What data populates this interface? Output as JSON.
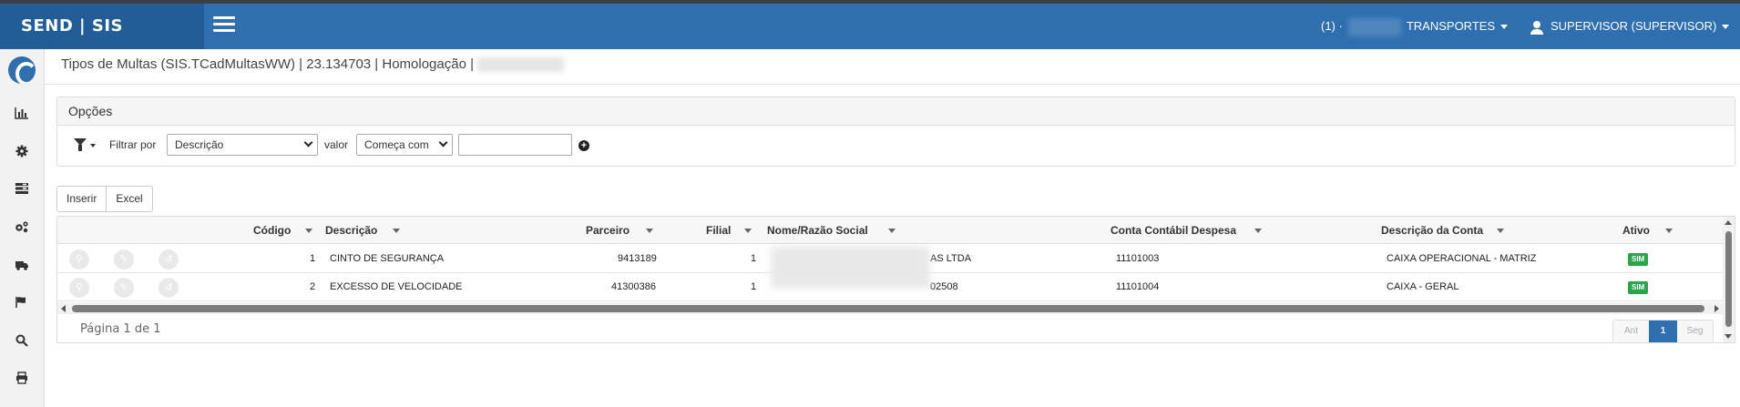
{
  "header": {
    "brand": "SEND | SIS",
    "tenant_prefix": "(1) ·",
    "tenant_name": "TRANSPORTES",
    "user": "SUPERVISOR (SUPERVISOR)"
  },
  "sidebar": {
    "icons": [
      "chart-icon",
      "gear-icon",
      "list-icon",
      "gears-icon",
      "truck-icon",
      "flag-icon",
      "search-icon",
      "print-icon"
    ]
  },
  "page": {
    "title": "Tipos de Multas (SIS.TCadMultasWW) | 23.134703 | Homologação |"
  },
  "options": {
    "heading": "Opções",
    "filter_by_label": "Filtrar por",
    "filter_field": "Descrição",
    "value_label": "valor",
    "operator": "Começa com",
    "value": ""
  },
  "actions": {
    "insert": "Inserir",
    "excel": "Excel"
  },
  "grid": {
    "columns": [
      "Código",
      "Descrição",
      "Parceiro",
      "Filial",
      "Nome/Razão Social",
      "Conta Contábil Despesa",
      "Descrição da Conta",
      "Ativo"
    ],
    "rows": [
      {
        "codigo": "1",
        "descricao": "CINTO DE SEGURANÇA",
        "parceiro": "9413189",
        "filial": "1",
        "nome": "AS LTDA",
        "conta": "11101003",
        "descricao_conta": "CAIXA OPERACIONAL - MATRIZ",
        "ativo": "SIM"
      },
      {
        "codigo": "2",
        "descricao": "EXCESSO DE VELOCIDADE",
        "parceiro": "41300386",
        "filial": "1",
        "nome": "02508",
        "conta": "11101004",
        "descricao_conta": "CAIXA - GERAL",
        "ativo": "SIM"
      }
    ]
  },
  "pager": {
    "info": "Página 1 de 1",
    "prev": "Ant",
    "current": "1",
    "next": "Seg"
  },
  "colors": {
    "header_blue": "#2f6fb0",
    "brand_blue": "#235d97",
    "badge_green": "#2aa54a"
  }
}
